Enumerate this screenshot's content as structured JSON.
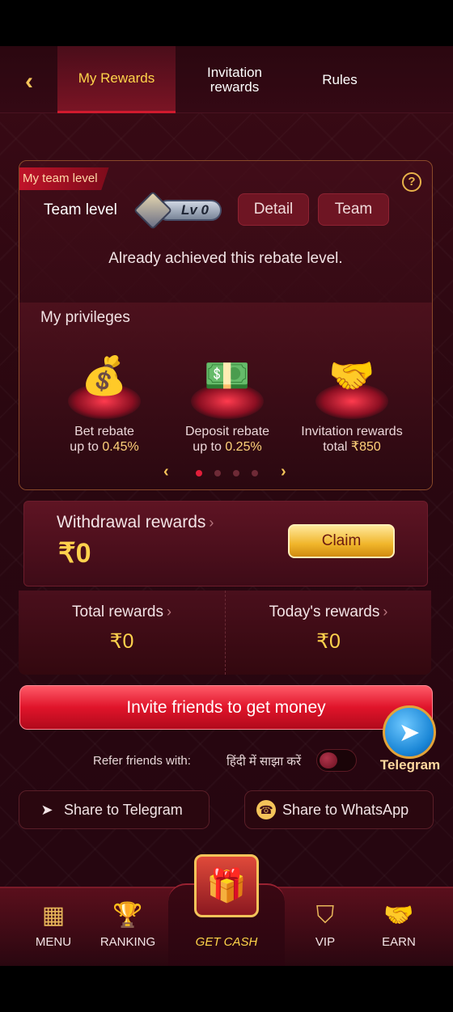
{
  "header": {
    "back_icon": "back-arrow-icon",
    "tabs": [
      {
        "label": "My Rewards",
        "active": true
      },
      {
        "label": "Invitation rewards",
        "active": false
      },
      {
        "label": "Rules",
        "active": false
      }
    ]
  },
  "team_card": {
    "ribbon": "My team level",
    "help_icon": "question-mark-icon",
    "team_level_label": "Team level",
    "level_badge": "Lv 0",
    "detail_label": "Detail",
    "team_label": "Team",
    "status_text": "Already achieved this rebate level."
  },
  "privileges": {
    "title": "My privileges",
    "items": [
      {
        "label": "Bet rebate",
        "value_prefix": "up to ",
        "value": "0.45%",
        "icon": "coins-gems-icon"
      },
      {
        "label": "Deposit rebate",
        "value_prefix": "up to ",
        "value": "0.25%",
        "icon": "cash-chest-icon"
      },
      {
        "label": "Invitation rewards",
        "value_prefix": "total ",
        "value": "₹850",
        "icon": "handshake-icon"
      }
    ],
    "page_count": 4,
    "current_page": 1
  },
  "withdrawal": {
    "label": "Withdrawal rewards",
    "amount": "₹0",
    "claim_label": "Claim"
  },
  "totals": {
    "total_label": "Total rewards",
    "total_value": "₹0",
    "today_label": "Today's rewards",
    "today_value": "₹0"
  },
  "invite_button": "Invite friends to get money",
  "telegram_fab": "Telegram",
  "refer": {
    "label": "Refer friends with:",
    "language": "हिंदी में साझा करें",
    "toggle_on": false
  },
  "share": {
    "telegram": "Share to Telegram",
    "whatsapp": "Share to WhatsApp"
  },
  "bottom_nav": {
    "menu": "MENU",
    "ranking": "RANKING",
    "get_cash": "GET CASH",
    "vip": "VIP",
    "earn": "EARN"
  },
  "colors": {
    "accent_gold": "#ffd24d",
    "accent_red": "#e0142a",
    "background": "#2a0710"
  }
}
